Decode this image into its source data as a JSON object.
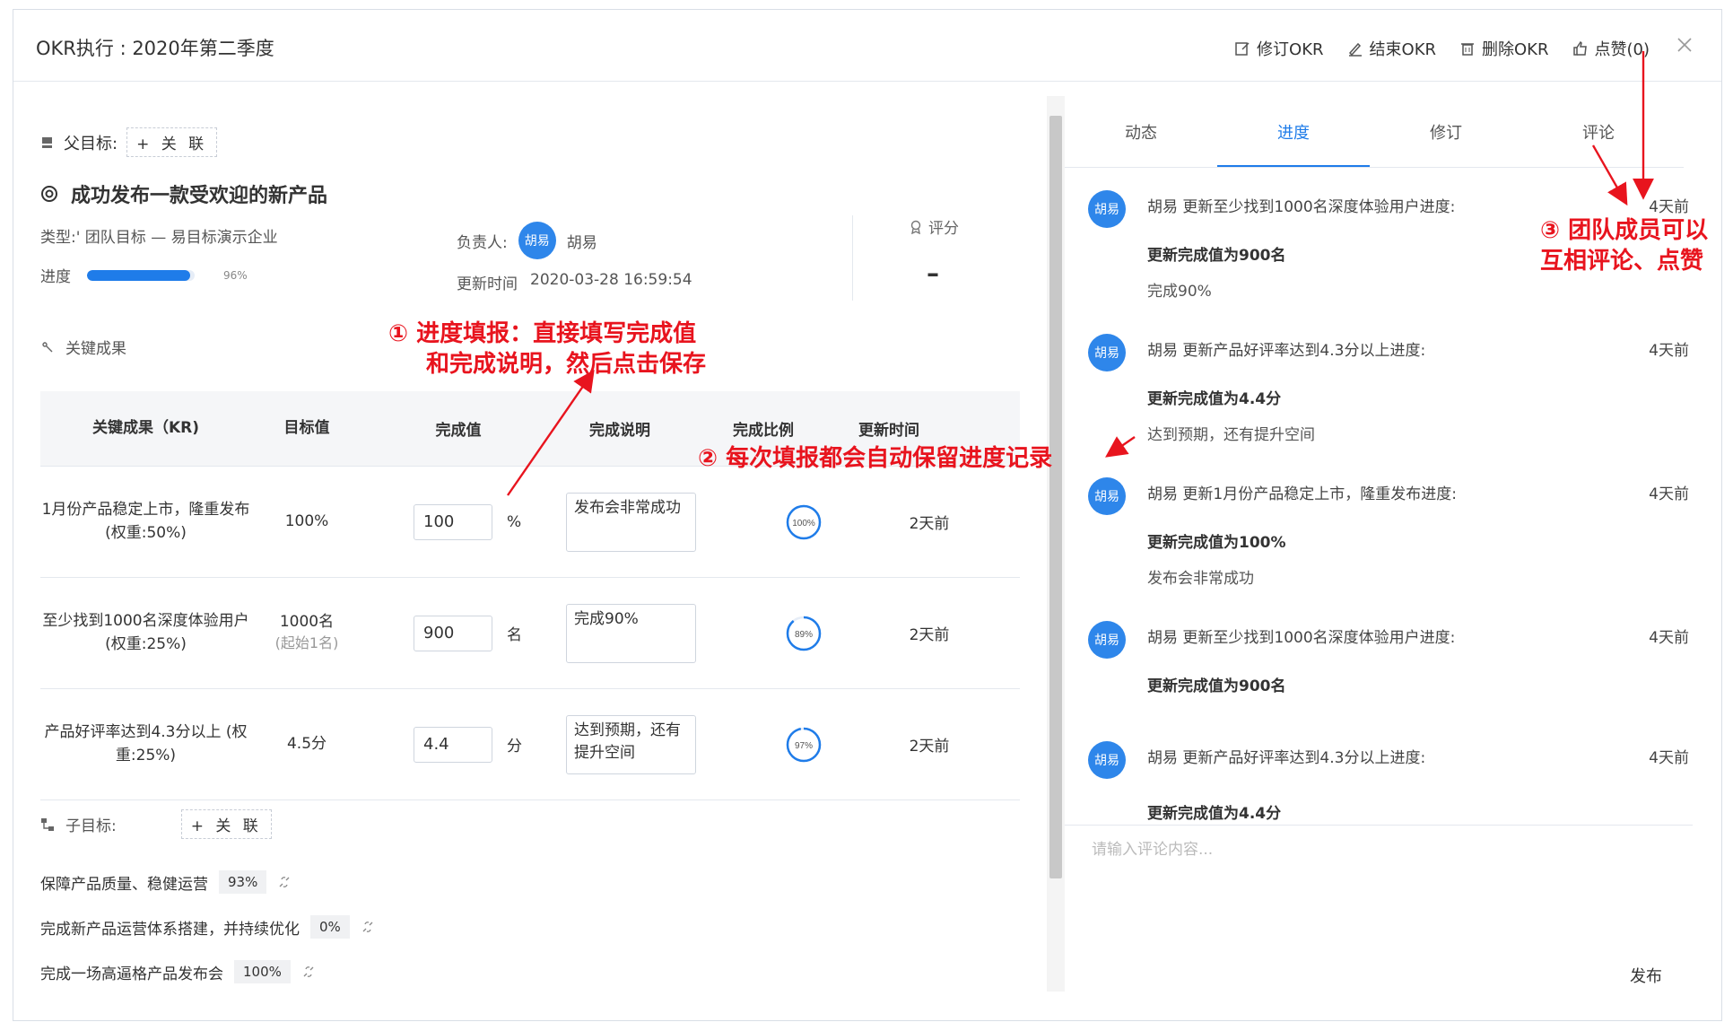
{
  "header": {
    "title": "OKR执行 : 2020年第二季度",
    "actions": [
      {
        "label": "修订OKR",
        "icon": "edit-icon"
      },
      {
        "label": "结束OKR",
        "icon": "pen-icon"
      },
      {
        "label": "删除OKR",
        "icon": "trash-icon"
      },
      {
        "label": "点赞(0)",
        "icon": "thumbs-up-icon"
      }
    ]
  },
  "objective": {
    "parent_label": "父目标:",
    "link_label": "+ 关 联",
    "title": "成功发布一款受欢迎的新产品",
    "type_text": "类型:' 团队目标 — 易目标演示企业",
    "progress_label": "进度",
    "progress_value": 0.96,
    "progress_text": "96%",
    "owner_label": "负责人:",
    "owner_avatar": "胡易",
    "owner_name": "胡易",
    "updated_label": "更新时间",
    "updated_value": "2020-03-28 16:59:54",
    "score_label": "评分",
    "score_value": "–"
  },
  "kr": {
    "heading": "关键成果",
    "columns": [
      "关键成果（KR)",
      "目标值",
      "完成值",
      "完成说明",
      "完成比例",
      "更新时间"
    ],
    "rows": [
      {
        "name": "1月份产品稳定上市，隆重发布 (权重:50%)",
        "target": "100%",
        "target_sub": "",
        "done": "100",
        "unit": "%",
        "note": "发布会非常成功",
        "ratio": 1.0,
        "ratio_text": "100%",
        "time": "2天前"
      },
      {
        "name": "至少找到1000名深度体验用户 (权重:25%)",
        "target": "1000名",
        "target_sub": "(起始1名)",
        "done": "900",
        "unit": "名",
        "note": "完成90%",
        "ratio": 0.89,
        "ratio_text": "89%",
        "time": "2天前"
      },
      {
        "name": "产品好评率达到4.3分以上 (权重:25%)",
        "target": "4.5分",
        "target_sub": "",
        "done": "4.4",
        "unit": "分",
        "note": "达到预期，还有提升空间",
        "ratio": 0.97,
        "ratio_text": "97%",
        "time": "2天前"
      }
    ]
  },
  "children": {
    "label": "子目标:",
    "link_label": "+ 关 联",
    "items": [
      {
        "name": "保障产品质量、稳健运营",
        "pct": "93%"
      },
      {
        "name": "完成新产品运营体系搭建，并持续优化",
        "pct": "0%"
      },
      {
        "name": "完成一场高逼格产品发布会",
        "pct": "100%"
      }
    ]
  },
  "tabs": [
    "动态",
    "进度",
    "修订",
    "评论"
  ],
  "active_tab": 1,
  "feed": [
    {
      "avatar": "胡易",
      "line": "胡易 更新至少找到1000名深度体验用户进度:",
      "time": "4天前",
      "bold": "更新完成值为900名",
      "note": "完成90%"
    },
    {
      "avatar": "胡易",
      "line": "胡易 更新产品好评率达到4.3分以上进度:",
      "time": "4天前",
      "bold": "更新完成值为4.4分",
      "note": "达到预期，还有提升空间"
    },
    {
      "avatar": "胡易",
      "line": "胡易 更新1月份产品稳定上市，隆重发布进度:",
      "time": "4天前",
      "bold": "更新完成值为100%",
      "note": "发布会非常成功"
    },
    {
      "avatar": "胡易",
      "line": "胡易 更新至少找到1000名深度体验用户进度:",
      "time": "4天前",
      "bold": "更新完成值为900名",
      "note": ""
    },
    {
      "avatar": "胡易",
      "line": "胡易 更新产品好评率达到4.3分以上进度:",
      "time": "4天前",
      "bold": "更新完成值为4.4分",
      "note": ""
    }
  ],
  "comment": {
    "placeholder": "请输入评论内容...",
    "publish_label": "发布"
  },
  "annotations": {
    "a1_line1": "① 进度填报：直接填写完成值",
    "a1_line2": "和完成说明，然后点击保存",
    "a2": "② 每次填报都会自动保留进度记录",
    "a3_line1": "③ 团队成员可以",
    "a3_line2": "互相评论、点赞"
  },
  "colors": {
    "accent": "#1f7ce9",
    "annotation": "#e8141e"
  }
}
